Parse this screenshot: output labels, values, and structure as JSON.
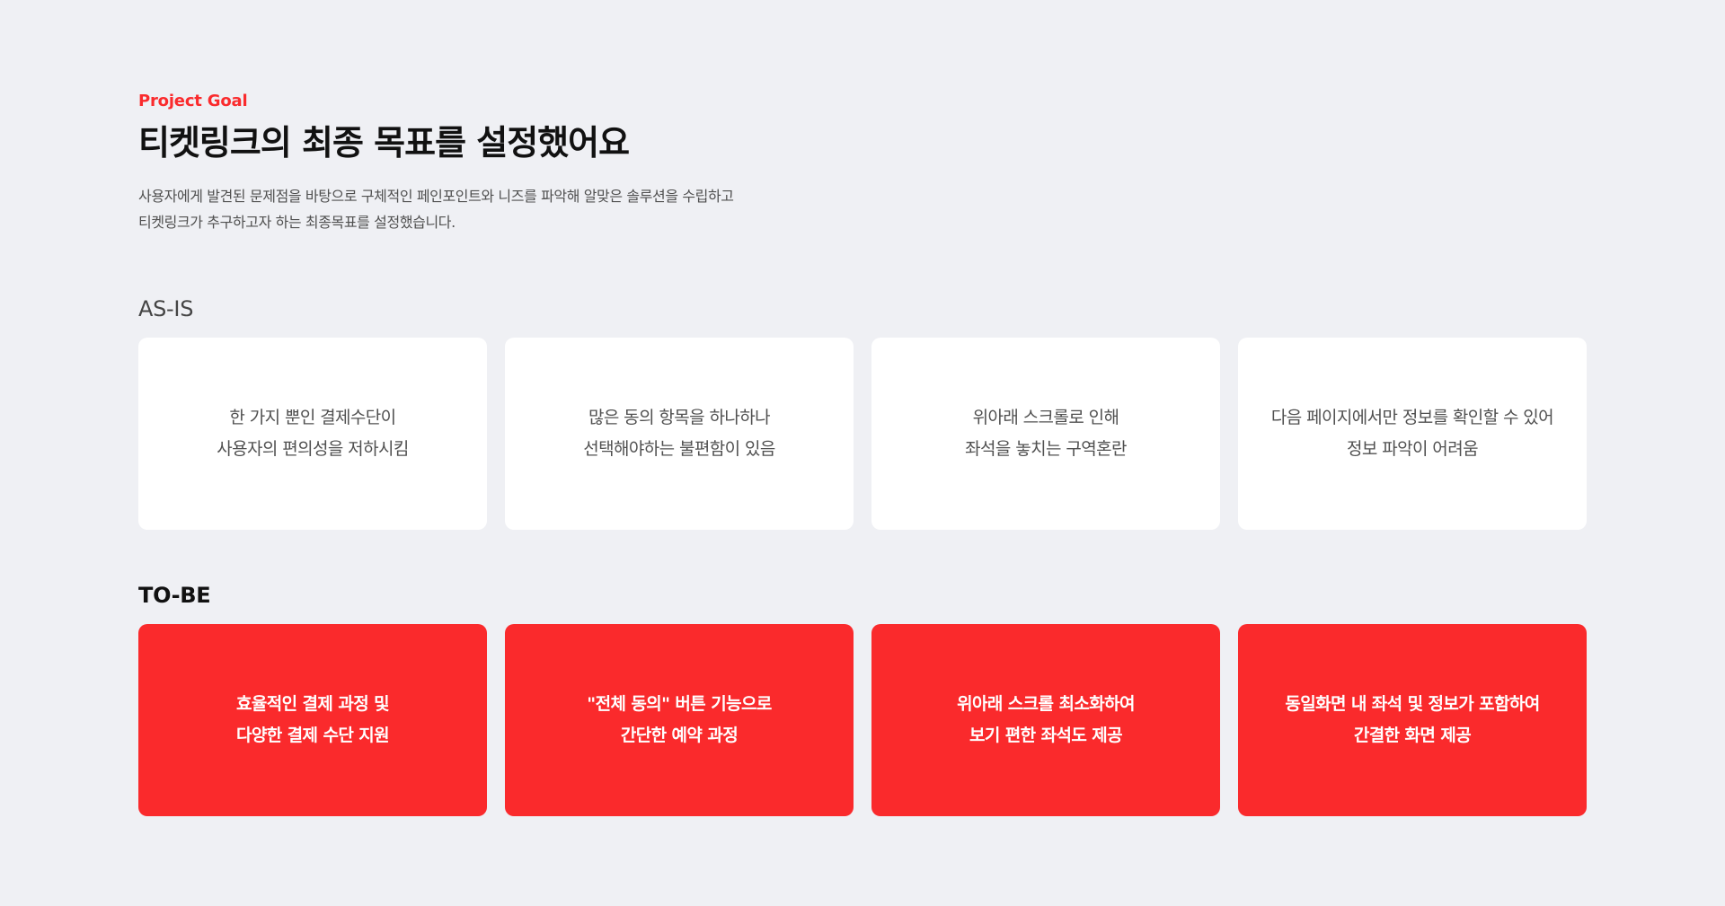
{
  "header": {
    "eyebrow": "Project Goal",
    "title": "티켓링크의 최종 목표를 설정했어요",
    "description_lines": [
      "사용자에게 발견된 문제점을 바탕으로 구체적인 페인포인트와 니즈를 파악해 알맞은 솔루션을 수립하고",
      "티켓링크가 추구하고자 하는 최종목표를 설정했습니다."
    ]
  },
  "as_is": {
    "label": "AS-IS",
    "cards": [
      {
        "line1": "한 가지 뿐인 결제수단이",
        "line2": "사용자의 편의성을 저하시킴"
      },
      {
        "line1": "많은 동의 항목을 하나하나",
        "line2": "선택해야하는 불편함이 있음"
      },
      {
        "line1": "위아래 스크롤로 인해",
        "line2": "좌석을 놓치는 구역혼란"
      },
      {
        "line1": "다음 페이지에서만 정보를 확인할 수 있어",
        "line2": "정보 파악이 어려움"
      }
    ]
  },
  "to_be": {
    "label": "TO-BE",
    "cards": [
      {
        "line1": "효율적인 결제 과정 및",
        "line2": "다양한 결제 수단 지원"
      },
      {
        "line1": "\"전체 동의\" 버튼 기능으로",
        "line2": "간단한 예약 과정"
      },
      {
        "line1": "위아래 스크롤 최소화하여",
        "line2": "보기 편한 좌석도 제공"
      },
      {
        "line1": "동일화면 내 좌석 및 정보가 포함하여",
        "line2": "간결한 화면 제공"
      }
    ]
  },
  "colors": {
    "background": "#eff0f4",
    "accent": "#fa2b2d",
    "card_asis_bg": "#ffffff",
    "card_tobe_bg": "#fa2a2c",
    "title": "#111111",
    "body_text": "#505050"
  }
}
